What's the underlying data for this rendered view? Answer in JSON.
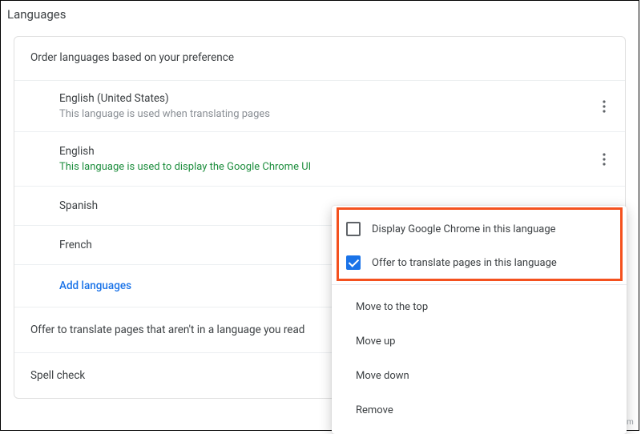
{
  "title": "Languages",
  "order_label": "Order languages based on your preference",
  "languages": [
    {
      "name": "English (United States)",
      "subtitle": "This language is used when translating pages",
      "subtitle_green": false
    },
    {
      "name": "English",
      "subtitle": "This language is used to display the Google Chrome UI",
      "subtitle_green": true
    },
    {
      "name": "Spanish",
      "subtitle": "",
      "subtitle_green": false
    },
    {
      "name": "French",
      "subtitle": "",
      "subtitle_green": false
    }
  ],
  "add_languages": "Add languages",
  "offer_translate_row": "Offer to translate pages that aren't in a language you read",
  "spell_check_row": "Spell check",
  "menu": {
    "display_in_lang": {
      "label": "Display Google Chrome in this language",
      "checked": false
    },
    "offer_translate": {
      "label": "Offer to translate pages in this language",
      "checked": true
    },
    "move_top": "Move to the top",
    "move_up": "Move up",
    "move_down": "Move down",
    "remove": "Remove"
  },
  "watermark": "wsxdn.com"
}
